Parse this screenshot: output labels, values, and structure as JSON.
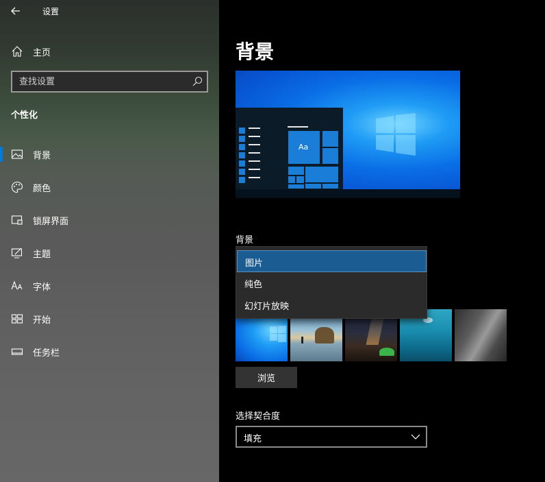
{
  "app": {
    "title": "设置"
  },
  "sidebar": {
    "home_label": "主页",
    "search_placeholder": "查找设置",
    "section_title": "个性化",
    "items": [
      {
        "label": "背景",
        "icon": "image-icon",
        "selected": true
      },
      {
        "label": "颜色",
        "icon": "palette-icon",
        "selected": false
      },
      {
        "label": "锁屏界面",
        "icon": "lock-screen-icon",
        "selected": false
      },
      {
        "label": "主题",
        "icon": "theme-icon",
        "selected": false
      },
      {
        "label": "字体",
        "icon": "font-icon",
        "selected": false
      },
      {
        "label": "开始",
        "icon": "start-icon",
        "selected": false
      },
      {
        "label": "任务栏",
        "icon": "taskbar-icon",
        "selected": false
      }
    ]
  },
  "main": {
    "page_title": "背景",
    "preview_tile_text": "Aa",
    "background_label": "背景",
    "background_options": [
      "图片",
      "纯色",
      "幻灯片放映"
    ],
    "background_selected": "图片",
    "browse_label": "浏览",
    "fit_label": "选择契合度",
    "fit_value": "填充"
  },
  "colors": {
    "accent": "#0078d7",
    "menu_highlight": "#1b5d93",
    "main_bg": "#000000"
  }
}
